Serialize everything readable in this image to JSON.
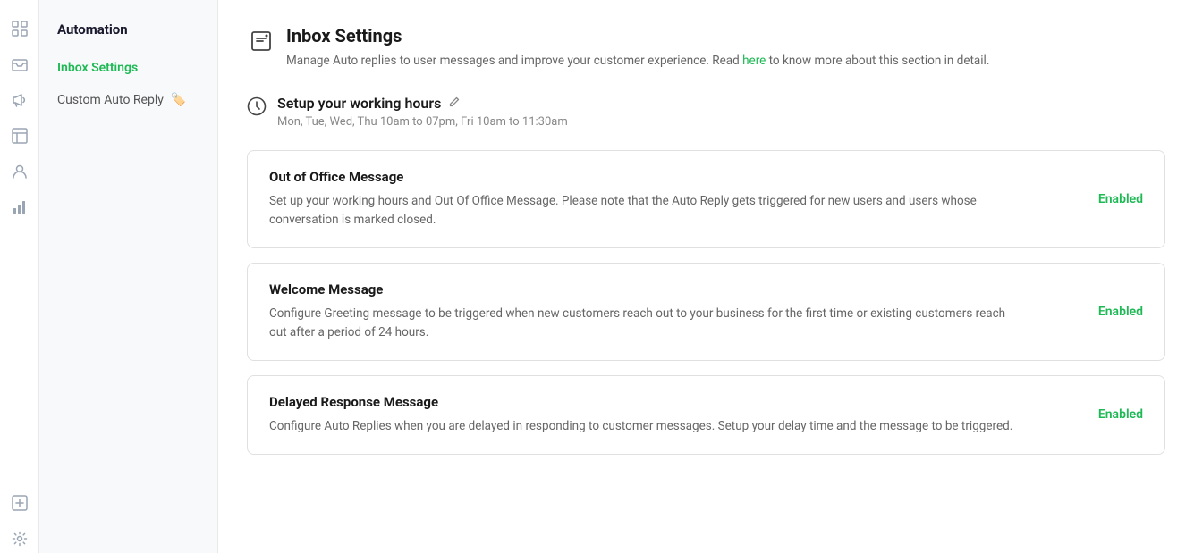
{
  "app": {
    "title": "Automation"
  },
  "iconRail": {
    "icons": [
      {
        "name": "grid-icon",
        "glyph": "⊞",
        "interactable": true
      },
      {
        "name": "inbox-icon",
        "glyph": "⬚",
        "interactable": true
      },
      {
        "name": "megaphone-icon",
        "glyph": "📣",
        "interactable": true
      },
      {
        "name": "table-icon",
        "glyph": "⊟",
        "interactable": true
      },
      {
        "name": "contacts-icon",
        "glyph": "👥",
        "interactable": true
      },
      {
        "name": "chart-icon",
        "glyph": "📊",
        "interactable": true
      },
      {
        "name": "add-box-icon",
        "glyph": "⊕",
        "interactable": true
      },
      {
        "name": "settings-icon",
        "glyph": "⚙",
        "interactable": true
      }
    ]
  },
  "sidebar": {
    "title": "Automation",
    "items": [
      {
        "id": "inbox-settings",
        "label": "Inbox Settings",
        "active": true,
        "emoji": ""
      },
      {
        "id": "custom-auto-reply",
        "label": "Custom Auto Reply",
        "active": false,
        "emoji": "🏷️"
      }
    ]
  },
  "main": {
    "pageTitle": "Inbox Settings",
    "pageDesc": "Manage Auto replies to user messages and improve your customer experience. Read ",
    "pageLinkText": "here",
    "pageDescSuffix": " to know more about this section in detail.",
    "workingHours": {
      "title": "Setup your working hours",
      "schedule": "Mon, Tue, Wed, Thu 10am to 07pm, Fri 10am to 11:30am"
    },
    "cards": [
      {
        "id": "out-of-office",
        "title": "Out of Office Message",
        "desc": "Set up your working hours and Out Of Office Message. Please note that the Auto Reply gets triggered for new users and users whose conversation is marked closed.",
        "status": "Enabled"
      },
      {
        "id": "welcome-message",
        "title": "Welcome Message",
        "desc": "Configure Greeting message to be triggered when new customers reach out to your business for the first time or existing customers reach out after a period of 24 hours.",
        "status": "Enabled"
      },
      {
        "id": "delayed-response",
        "title": "Delayed Response Message",
        "desc": "Configure Auto Replies when you are delayed in responding to customer messages. Setup your delay time and the message to be triggered.",
        "status": "Enabled"
      }
    ]
  }
}
